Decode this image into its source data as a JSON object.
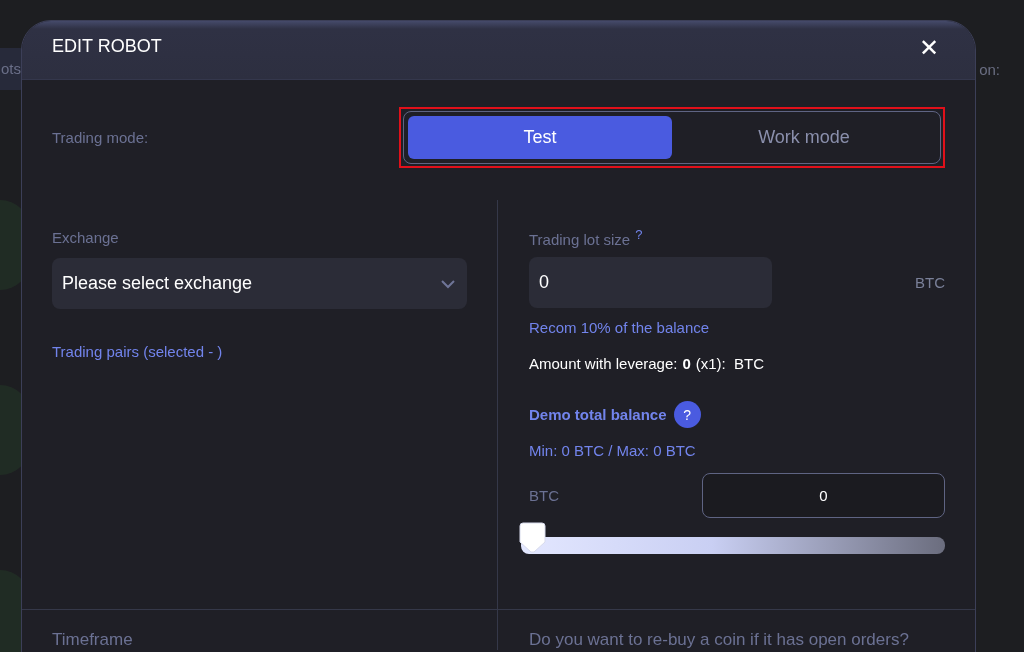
{
  "background": {
    "left_tab": "ots",
    "right_label": "on:"
  },
  "dialog": {
    "title": "EDIT ROBOT",
    "close": "✕"
  },
  "trading_mode": {
    "label": "Trading mode:",
    "options": [
      {
        "label": "Test",
        "selected": true
      },
      {
        "label": "Work mode",
        "selected": false
      }
    ]
  },
  "exchange": {
    "label": "Exchange",
    "placeholder": "Please select exchange",
    "pairs_link": "Trading pairs (selected - )"
  },
  "lot": {
    "label": "Trading lot size",
    "hint_mark": "?",
    "value": "0",
    "unit": "BTC",
    "recommendation": "Recom 10% of the balance",
    "leverage_label": "Amount with leverage:",
    "leverage_value": "0",
    "leverage_rest": "(x1):  BTC"
  },
  "demo": {
    "label": "Demo total balance",
    "help": "?",
    "range": "Min: 0 BTC / Max: 0 BTC",
    "unit": "BTC",
    "value": "0",
    "level": 0
  },
  "bottom": {
    "left": "Timeframe",
    "right": "Do you want to re-buy a coin if it has open orders?"
  }
}
